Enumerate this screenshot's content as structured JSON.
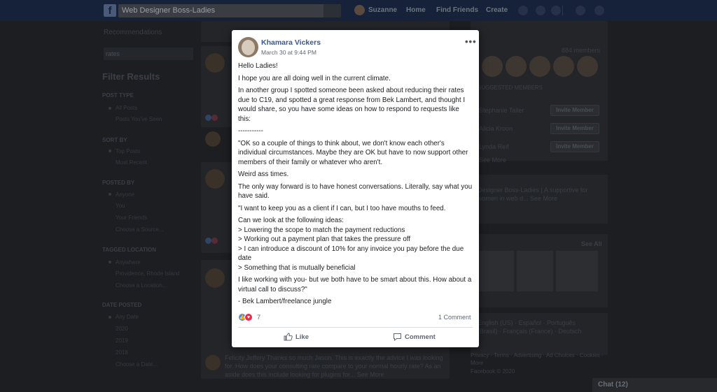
{
  "topbar": {
    "search_value": "Web Designer Boss-Ladies",
    "user_name": "Suzanne",
    "nav": [
      "Home",
      "Find Friends",
      "Create"
    ]
  },
  "left": {
    "recommendations": "Recommendations",
    "search_value": "rates",
    "filter_title": "Filter Results",
    "sections": [
      {
        "title": "POST TYPE",
        "options": [
          "All Posts",
          "Posts You've Seen"
        ]
      },
      {
        "title": "SORT BY",
        "options": [
          "Top Posts",
          "Most Recent"
        ]
      },
      {
        "title": "POSTED BY",
        "options": [
          "Anyone",
          "You",
          "Your Friends",
          "Choose a Source..."
        ]
      },
      {
        "title": "TAGGED LOCATION",
        "options": [
          "Anywhere",
          "Providence, Rhode Island",
          "Choose a Location..."
        ]
      },
      {
        "title": "DATE POSTED",
        "options": [
          "Any Date",
          "2020",
          "2019",
          "2018",
          "Choose a Date..."
        ]
      }
    ]
  },
  "feed": {
    "bottom_comment": "Felicity Jeffery Thanks so much Jason. This is exactly the advice I was looking for. How does your consulting rate compare to your normal hourly rate? As an aside does this include looking for plugins for... See More"
  },
  "right": {
    "members_count": "884 members",
    "suggested_heading": "SUGGESTED MEMBERS",
    "invite_label": "Invite Member",
    "suggested": [
      "Stephanie Taller",
      "Alicia Kroon",
      "Lynda Reif"
    ],
    "see_more": "See More",
    "description": "Designer Boss-Ladies | A supportive for women in web d... See More",
    "see_all": "See All",
    "languages": "English (US) · Español · Português (Brasil) · Français (France) · Deutsch",
    "footer": "Privacy · Terms · Advertising · Ad Choices · Cookies · More",
    "copyright": "Facebook © 2020"
  },
  "chat": {
    "label": "Chat (12)"
  },
  "post": {
    "author": "Khamara Vickers",
    "date": "March 30 at 9:44 PM",
    "paragraphs": [
      "Hello Ladies!",
      "I hope you are all doing well in the current climate.",
      "In another group I spotted someone been asked about reducing their rates due to C19, and spotted a great response from Bek Lambert, and thought I would share, so you have some ideas on how to respond to requests like this:",
      "-----------",
      "\"OK so a couple of things to think about, we don't know each other's individual circumstances. Maybe they are OK but have to now support other members of their family or whatever who aren't.",
      "Weird ass times.",
      "The only way forward is to have honest conversations. Literally, say what you have said.",
      "\"I want to keep you as a client if I can, but I too have mouths to feed.",
      "Can we look at the following ideas:\n> Lowering the scope to match the payment reductions\n> Working out a payment plan that takes the pressure off\n> I can introduce a discount of 10% for any invoice you pay before the due date\n> Something that is mutually beneficial",
      "I like working with you- but we both have to be smart about this. How about a virtual call to discuss?\"",
      "- Bek Lambert/freelance jungle"
    ],
    "reaction_count": "7",
    "comment_count": "1 Comment",
    "like_label": "Like",
    "comment_label": "Comment"
  },
  "colors": {
    "link_blue": "#365899",
    "like_blue": "#4a8cf0",
    "love_red": "#f0284a",
    "topbar": "#15223a"
  }
}
